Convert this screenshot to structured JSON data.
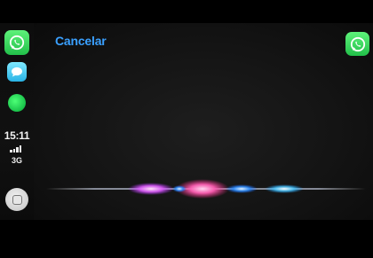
{
  "status": {
    "time": "15:11",
    "network": "3G"
  },
  "dock": {
    "apps": [
      {
        "name": "whatsapp",
        "icon": "whatsapp-icon"
      },
      {
        "name": "messages",
        "icon": "messages-icon"
      },
      {
        "name": "spotify",
        "icon": "spotify-icon"
      }
    ],
    "home_icon": "home-button-icon"
  },
  "siri": {
    "cancel_label": "Cancelar",
    "current_app_icon": "whatsapp-icon",
    "waveform_icon": "siri-waveform-icon"
  },
  "colors": {
    "accent": "#3aa0ff",
    "whatsapp_green": "#25d366",
    "background": "#000000"
  }
}
